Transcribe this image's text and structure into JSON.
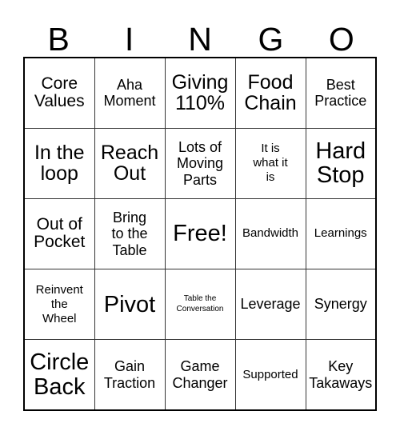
{
  "card": {
    "header_letters": [
      "B",
      "I",
      "N",
      "G",
      "O"
    ],
    "border_color": "#000000",
    "grid_line_color": "#333333",
    "background_color": "#ffffff",
    "text_color": "#000000",
    "rows": [
      [
        {
          "label": "Core\nValues",
          "size": "lg"
        },
        {
          "label": "Aha\nMoment",
          "size": "md"
        },
        {
          "label": "Giving\n110%",
          "size": "xl"
        },
        {
          "label": "Food\nChain",
          "size": "xl"
        },
        {
          "label": "Best\nPractice",
          "size": "md"
        }
      ],
      [
        {
          "label": "In the\nloop",
          "size": "xl"
        },
        {
          "label": "Reach\nOut",
          "size": "xl"
        },
        {
          "label": "Lots of\nMoving\nParts",
          "size": "md"
        },
        {
          "label": "It is\nwhat it\nis",
          "size": "sm"
        },
        {
          "label": "Hard\nStop",
          "size": "xxl"
        }
      ],
      [
        {
          "label": "Out of\nPocket",
          "size": "lg"
        },
        {
          "label": "Bring\nto the\nTable",
          "size": "md"
        },
        {
          "label": "Free!",
          "size": "xxl"
        },
        {
          "label": "Bandwidth",
          "size": "sm"
        },
        {
          "label": "Learnings",
          "size": "sm"
        }
      ],
      [
        {
          "label": "Reinvent\nthe\nWheel",
          "size": "sm"
        },
        {
          "label": "Pivot",
          "size": "xxl"
        },
        {
          "label": "Table the\nConversation",
          "size": "xxs"
        },
        {
          "label": "Leverage",
          "size": "md"
        },
        {
          "label": "Synergy",
          "size": "md"
        }
      ],
      [
        {
          "label": "Circle\nBack",
          "size": "xxl"
        },
        {
          "label": "Gain\nTraction",
          "size": "md"
        },
        {
          "label": "Game\nChanger",
          "size": "md"
        },
        {
          "label": "Supported",
          "size": "sm"
        },
        {
          "label": "Key\nTakaways",
          "size": "md"
        }
      ]
    ]
  }
}
